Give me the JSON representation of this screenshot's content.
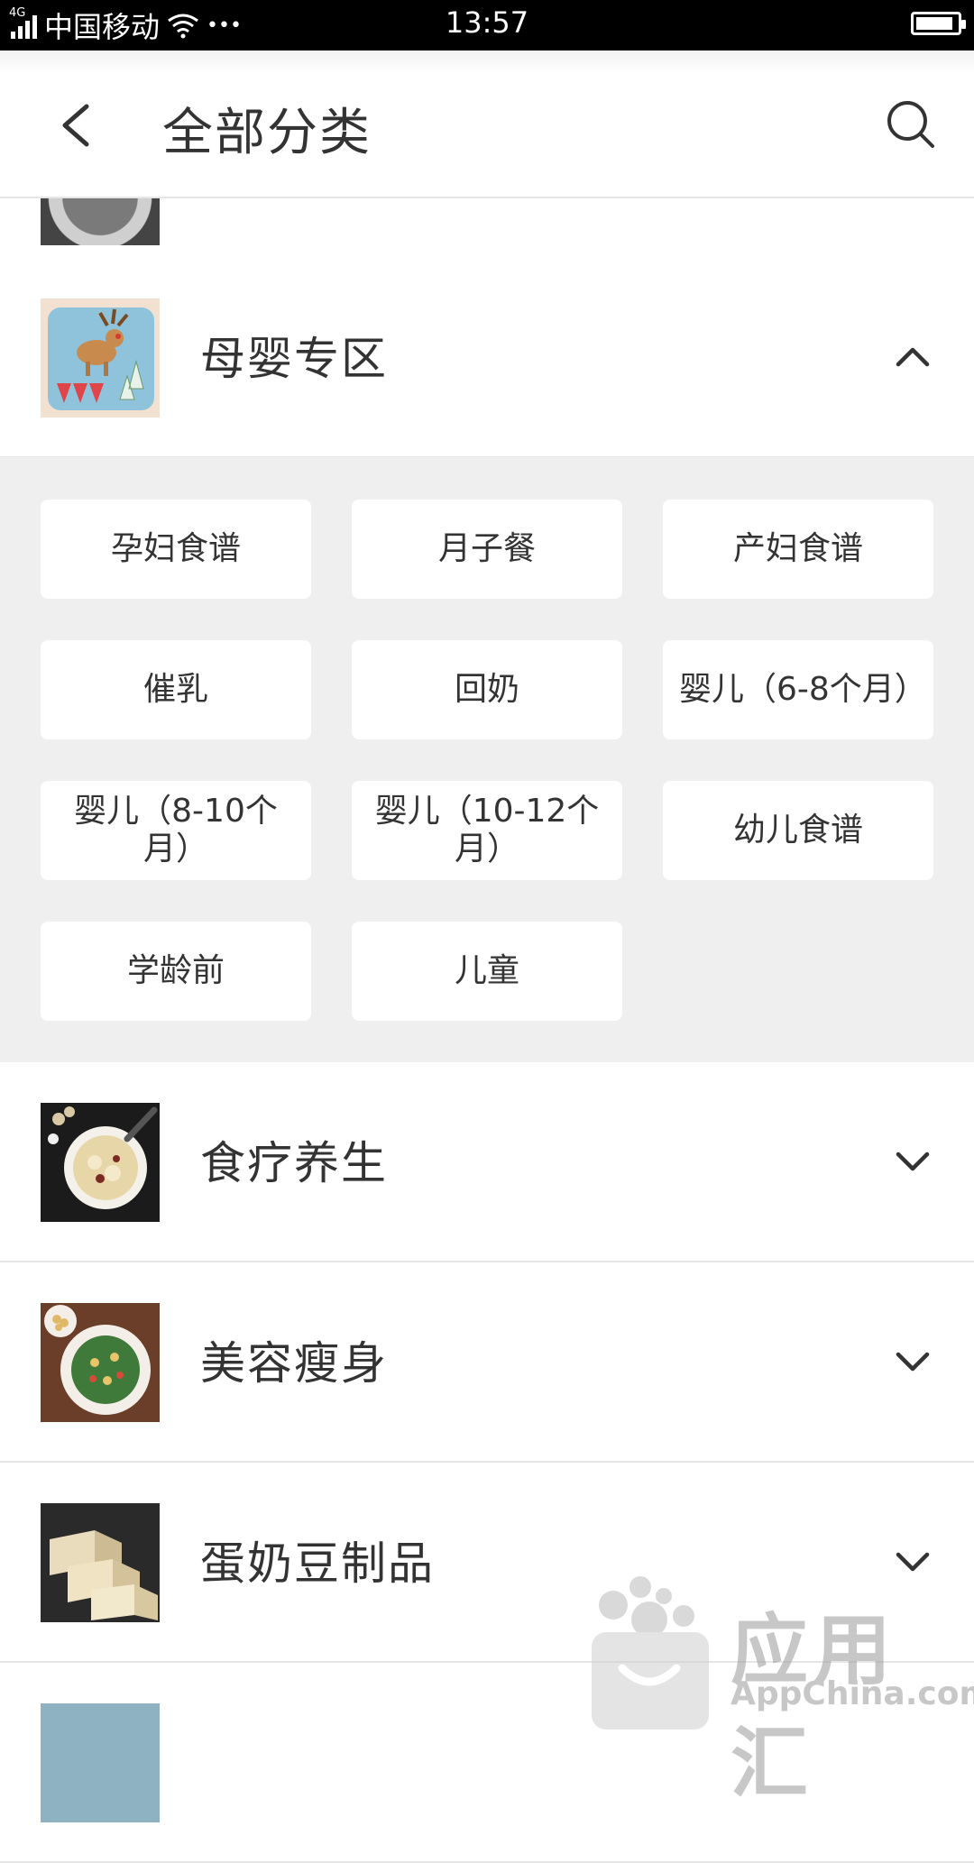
{
  "status_bar": {
    "network": "4G",
    "carrier": "中国移动",
    "more": "•••",
    "time": "13:57",
    "battery_level_pct": 90
  },
  "header": {
    "title": "全部分类",
    "back_icon": "chevron-left-icon",
    "search_icon": "search-icon"
  },
  "categories": [
    {
      "label": "母婴专区",
      "expanded": true,
      "chevron": "chevron-up-icon"
    },
    {
      "label": "食疗养生",
      "expanded": false,
      "chevron": "chevron-down-icon"
    },
    {
      "label": "美容瘦身",
      "expanded": false,
      "chevron": "chevron-down-icon"
    },
    {
      "label": "蛋奶豆制品",
      "expanded": false,
      "chevron": "chevron-down-icon"
    }
  ],
  "subcategories": [
    "孕妇食谱",
    "月子餐",
    "产妇食谱",
    "催乳",
    "回奶",
    "婴儿（6-8个月）",
    "婴儿（8-10个月）",
    "婴儿（10-12个月）",
    "幼儿食谱",
    "学龄前",
    "儿童"
  ],
  "watermark": {
    "brand": "应用汇",
    "domain": "AppChina.com"
  },
  "colors": {
    "status_bar": "#000000",
    "panel_bg": "#efefef",
    "text": "#333333",
    "divider": "#e6e6e6"
  }
}
